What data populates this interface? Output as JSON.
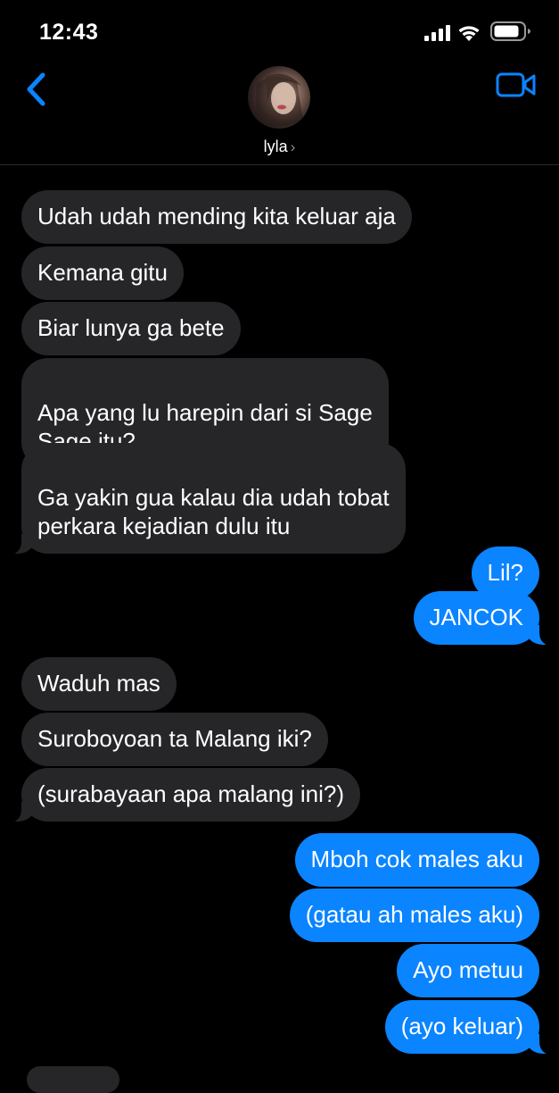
{
  "status_bar": {
    "time": "12:43"
  },
  "header": {
    "contact_name": "lyla",
    "chevron": "›"
  },
  "icons": {
    "back": "chevron-left-icon",
    "video": "video-camera-icon",
    "signal": "cellular-signal-icon",
    "wifi": "wifi-icon",
    "battery": "battery-icon"
  },
  "colors": {
    "accent": "#0a84ff",
    "incoming_bubble": "#262628",
    "background": "#000000"
  },
  "messages": [
    {
      "from": "them",
      "text": "Udah udah mending kita keluar aja"
    },
    {
      "from": "them",
      "text": "Kemana gitu"
    },
    {
      "from": "them",
      "text": "Biar lunya ga bete"
    },
    {
      "from": "them",
      "text": "Apa yang lu harepin dari si Sage\nSage itu?"
    },
    {
      "from": "them",
      "text": "Ga yakin gua kalau dia udah tobat\nperkara kejadian dulu itu"
    },
    {
      "from": "me",
      "text": "Lil?"
    },
    {
      "from": "me",
      "text": "JANCOK"
    },
    {
      "from": "them",
      "text": "Waduh mas"
    },
    {
      "from": "them",
      "text": "Suroboyoan ta Malang iki?"
    },
    {
      "from": "them",
      "text": "(surabayaan apa malang ini?)"
    },
    {
      "from": "me",
      "text": "Mboh cok males aku"
    },
    {
      "from": "me",
      "text": "(gatau ah males aku)"
    },
    {
      "from": "me",
      "text": "Ayo metuu"
    },
    {
      "from": "me",
      "text": "(ayo keluar)"
    }
  ]
}
